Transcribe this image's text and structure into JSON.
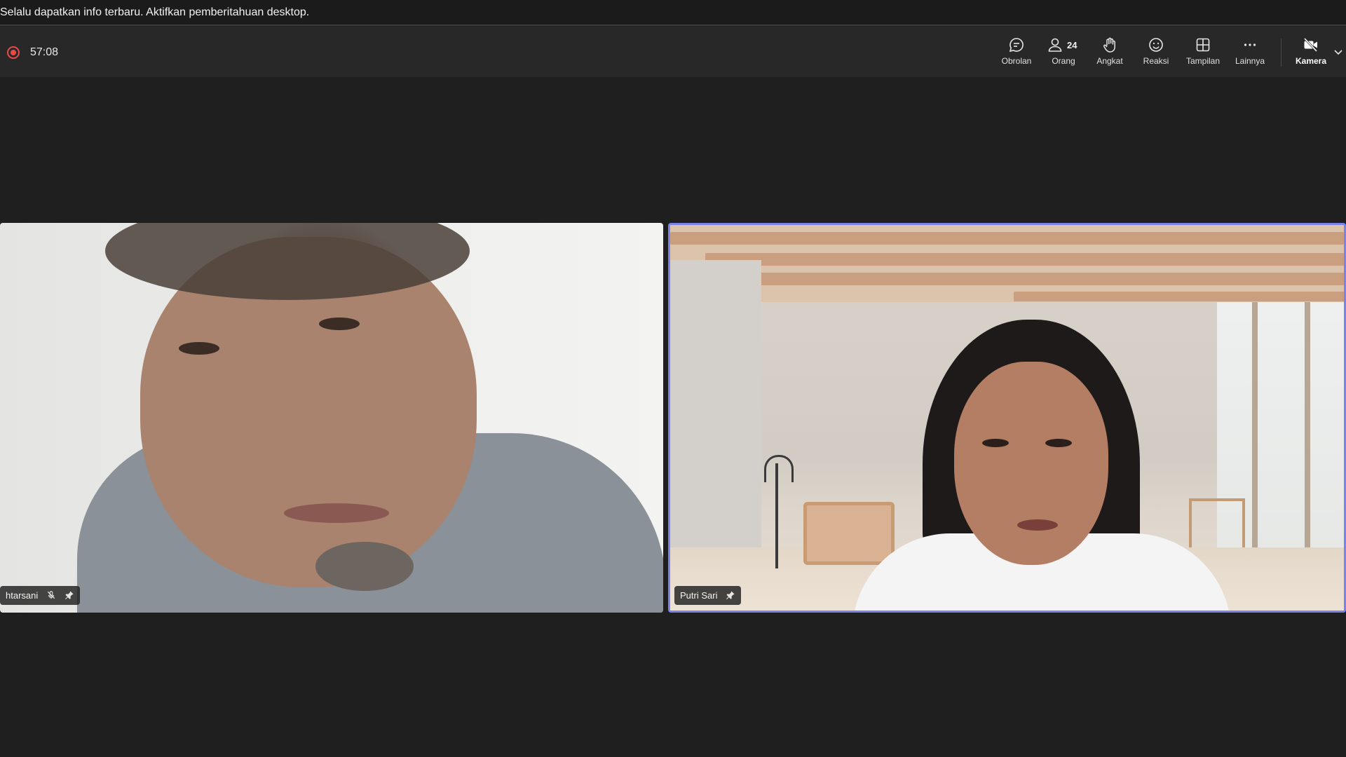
{
  "banner": {
    "text": "Selalu dapatkan info terbaru. Aktifkan pemberitahuan desktop."
  },
  "toolbar": {
    "recording_time": "57:08",
    "buttons": [
      {
        "label": "Obrolan",
        "icon": "chat-icon"
      },
      {
        "label": "Orang",
        "icon": "people-icon",
        "count": "24"
      },
      {
        "label": "Angkat",
        "icon": "raise-hand-icon"
      },
      {
        "label": "Reaksi",
        "icon": "smiley-icon"
      },
      {
        "label": "Tampilan",
        "icon": "layout-grid-icon"
      },
      {
        "label": "Lainnya",
        "icon": "more-icon"
      },
      {
        "label": "Kamera",
        "icon": "camera-off-icon"
      }
    ]
  },
  "participants": [
    {
      "name": "htarsani",
      "muted": true,
      "pinned": true
    },
    {
      "name": "Putri Sari",
      "muted": false,
      "pinned": true,
      "active_speaker": true
    }
  ],
  "colors": {
    "recording": "#e64a4a",
    "active_speaker_border": "#7b83eb",
    "toolbar_bg": "#282828",
    "stage_bg": "#1f1f1f"
  }
}
